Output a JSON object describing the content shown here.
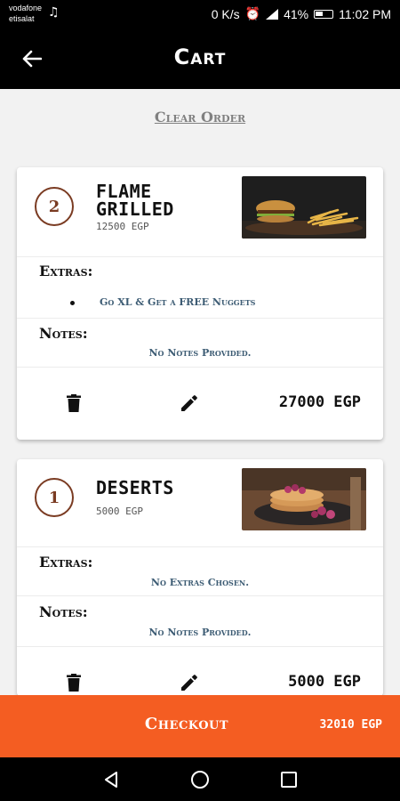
{
  "status_bar": {
    "carrier_1": "vodafone",
    "carrier_2": "etisalat",
    "speed": "0 K/s",
    "battery": "41%",
    "time": "11:02 PM",
    "icons": [
      "music-note-icon",
      "alarm-icon",
      "signal-icon",
      "battery-icon"
    ]
  },
  "app_bar": {
    "title": "Cart",
    "back_icon": "arrow-left-icon"
  },
  "clear_order_label": "Clear Order",
  "section_labels": {
    "extras": "Extras:",
    "notes": "Notes:"
  },
  "cart_items": [
    {
      "quantity": "2",
      "name": "FLAME GRILLED",
      "unit_price": "12500 EGP",
      "image_desc_icon": "burger-fries-image",
      "extras": [
        "Go XL & Get a FREE Nuggets"
      ],
      "notes": "No Notes Provided.",
      "line_total": "27000 EGP"
    },
    {
      "quantity": "1",
      "name": "DESERTS",
      "unit_price": "5000 EGP",
      "image_desc_icon": "pancakes-berries-image",
      "extras_empty": "No Extras Chosen.",
      "notes": "No Notes Provided.",
      "line_total": "5000 EGP"
    }
  ],
  "checkout": {
    "label": "Checkout",
    "total": "32010 EGP"
  },
  "colors": {
    "accent": "#f45d22",
    "qty_ring": "#7a3b22",
    "info_text": "#3d5c74",
    "app_bar": "#000000"
  }
}
